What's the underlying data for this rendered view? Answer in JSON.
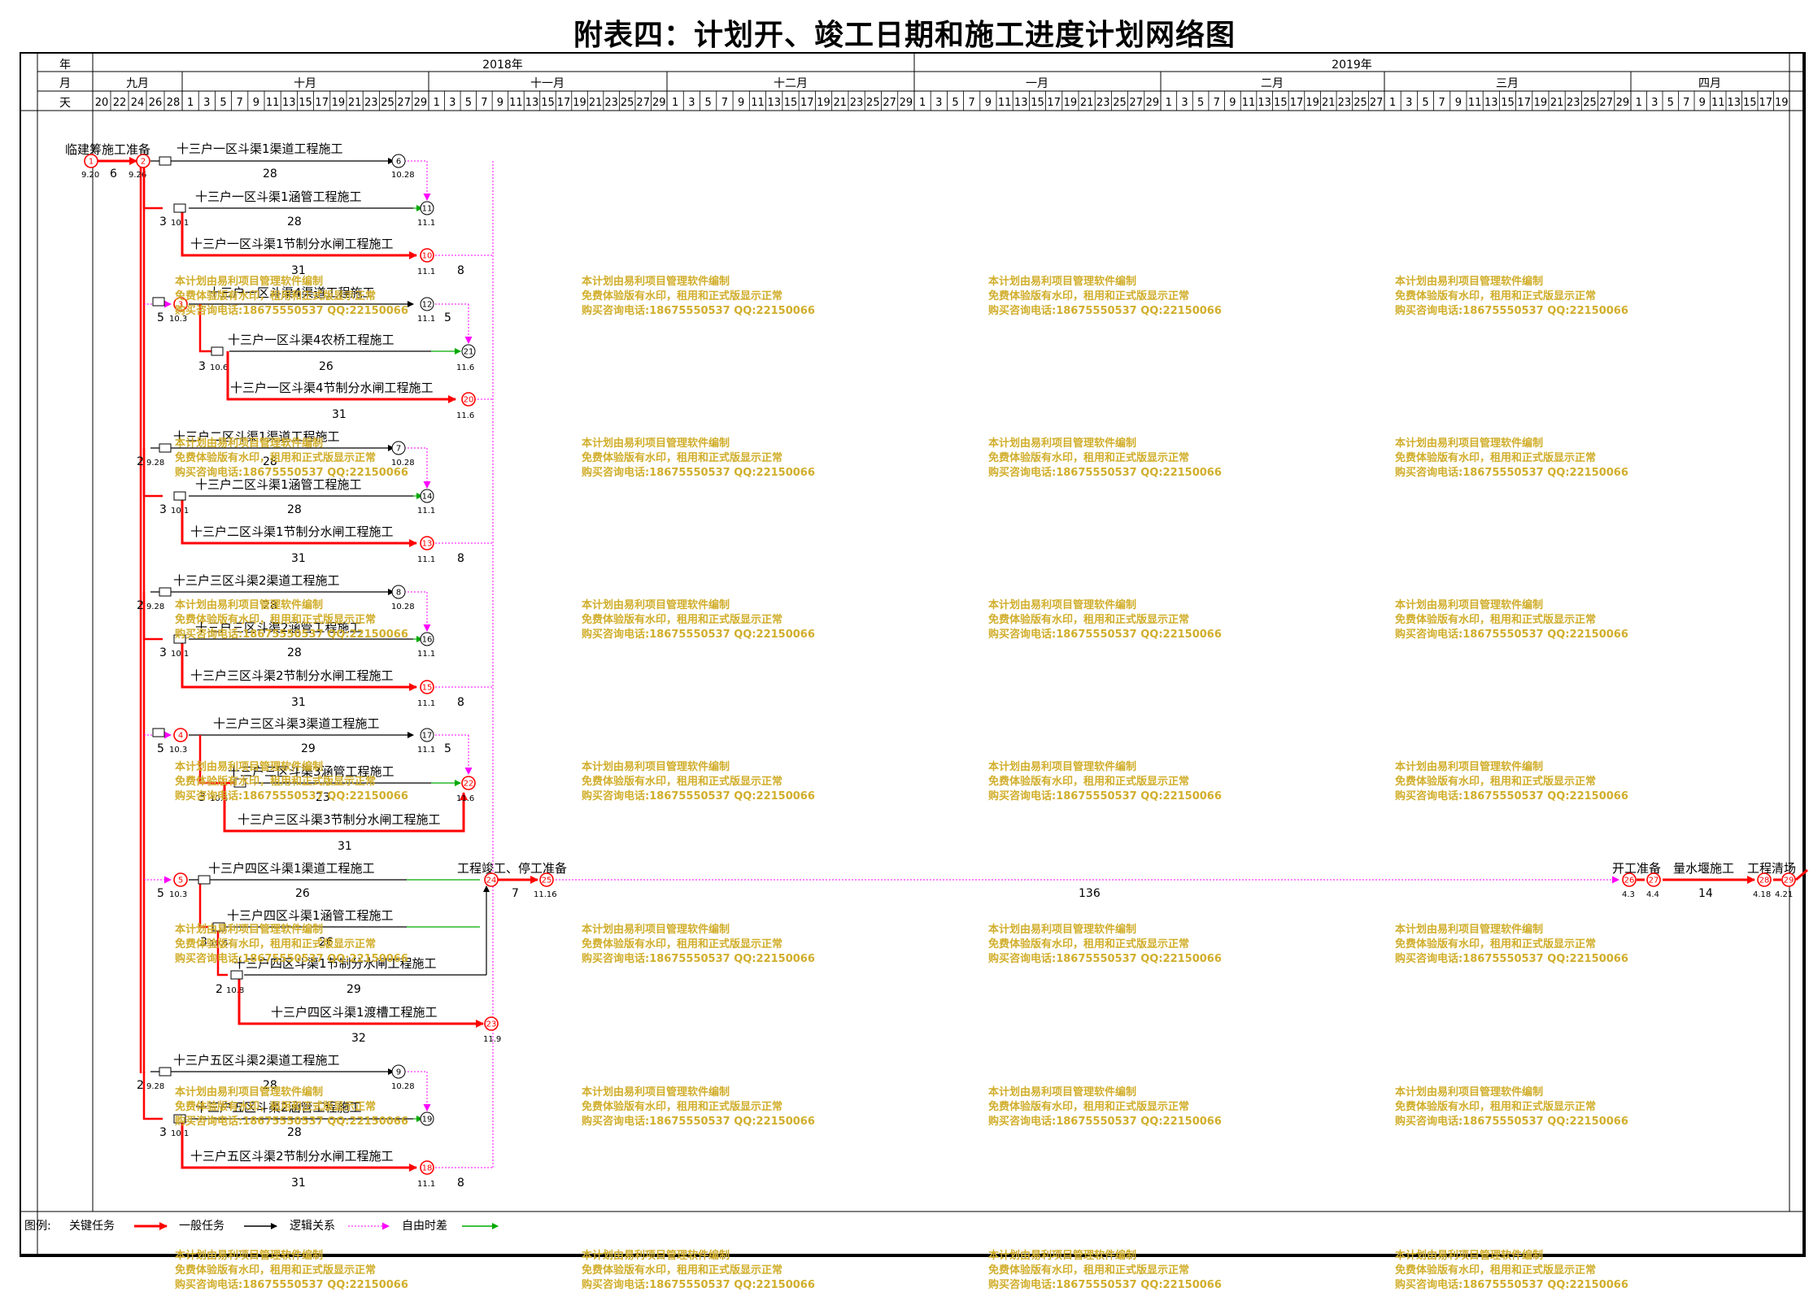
{
  "title": "附表四：计划开、竣工日期和施工进度计划网络图",
  "header": {
    "row_labels": [
      "年",
      "月",
      "天"
    ],
    "years": [
      "2018年",
      "2019年"
    ],
    "months": [
      "九月",
      "十月",
      "十一月",
      "十二月",
      "一月",
      "二月",
      "三月",
      "四月"
    ],
    "sep_days": [
      "20",
      "22",
      "24",
      "26",
      "28"
    ],
    "oct_days": [
      "1",
      "3",
      "5",
      "7",
      "9",
      "11",
      "13",
      "15",
      "17",
      "19",
      "21",
      "23",
      "25",
      "27",
      "29"
    ],
    "nov_days": [
      "1",
      "3",
      "5",
      "7",
      "9",
      "11",
      "13",
      "15",
      "17",
      "19",
      "21",
      "23",
      "25",
      "27",
      "29"
    ],
    "dec_days": [
      "1",
      "3",
      "5",
      "7",
      "9",
      "11",
      "13",
      "15",
      "17",
      "19",
      "21",
      "23",
      "25",
      "27",
      "29"
    ],
    "jan_days": [
      "1",
      "3",
      "5",
      "7",
      "9",
      "11",
      "13",
      "15",
      "17",
      "19",
      "21",
      "23",
      "25",
      "27",
      "29"
    ],
    "feb_days": [
      "1",
      "3",
      "5",
      "7",
      "9",
      "11",
      "13",
      "15",
      "17",
      "19",
      "21",
      "23",
      "25",
      "27"
    ],
    "mar_days": [
      "1",
      "3",
      "5",
      "7",
      "9",
      "11",
      "13",
      "15",
      "17",
      "19",
      "21",
      "23",
      "25",
      "27",
      "29"
    ],
    "apr_days": [
      "1",
      "3",
      "5",
      "7",
      "9",
      "11",
      "13",
      "15",
      "17",
      "19"
    ]
  },
  "tasks": {
    "prep": "临建筹施工准备",
    "r1_canal": "十三户一区斗渠1渠道工程施工",
    "r1_culvert": "十三户一区斗渠1涵管工程施工",
    "r1_sluice": "十三户一区斗渠1节制分水闸工程施工",
    "r1b_canal": "十三户一区斗渠4渠道工程施工",
    "r1b_bridge": "十三户一区斗渠4农桥工程施工",
    "r1b_sluice": "十三户一区斗渠4节制分水闸工程施工",
    "r2_canal": "十三户二区斗渠1渠道工程施工",
    "r2_culvert": "十三户二区斗渠1涵管工程施工",
    "r2_sluice": "十三户二区斗渠1节制分水闸工程施工",
    "r3_canal": "十三户三区斗渠2渠道工程施工",
    "r3_culvert": "十三户三区斗渠2涵管工程施工",
    "r3_sluice": "十三户三区斗渠2节制分水闸工程施工",
    "r3b_canal": "十三户三区斗渠3渠道工程施工",
    "r3b_culvert": "十三户三区斗渠3涵管工程施工",
    "r3b_sluice": "十三户三区斗渠3节制分水闸工程施工",
    "r4_canal": "十三户四区斗渠1渠道工程施工",
    "r4_culvert": "十三户四区斗渠1涵管工程施工",
    "r4_sluice": "十三户四区斗渠1节制分水闸工程施工",
    "r4_flume": "十三户四区斗渠1渡槽工程施工",
    "r5_canal": "十三户五区斗渠2渠道工程施工",
    "r5_culvert": "十三户五区斗渠2涵管工程施工",
    "r5_sluice": "十三户五区斗渠2节制分水闸工程施工",
    "stop": "工程竣工、停工准备",
    "restart": "开工准备",
    "cofferdam": "量水堰施工",
    "cleanup": "工程清场"
  },
  "durations": {
    "prep": "6",
    "r1_canal": "28",
    "r1_culvert": "28",
    "r1_sluice": "31",
    "r1b_bridge": "26",
    "r1b_sluice": "31",
    "r2_canal": "28",
    "r2_culvert": "28",
    "r2_sluice": "31",
    "r3_canal": "28",
    "r3_culvert": "28",
    "r3_sluice": "31",
    "r3b_canal": "29",
    "r3b_culvert": "23",
    "r3b_sluice": "31",
    "r4_canal": "26",
    "r4_culvert": "26",
    "r4_sluice": "29",
    "r4_flume": "32",
    "r5_canal": "28",
    "r5_culvert": "28",
    "r5_sluice": "31",
    "stop": "7",
    "winter": "136",
    "cofferdam": "14",
    "lag3": "3",
    "lag5": "5",
    "lag2": "2",
    "lag8": "8"
  },
  "dates": {
    "d0920": "9.20",
    "d0926": "9.26",
    "d0928": "9.28",
    "d101": "10.1",
    "d103": "10.3",
    "d106": "10.6",
    "d108": "10.8",
    "d1028": "10.28",
    "d111": "11.1",
    "d116": "11.6",
    "d119": "11.9",
    "d1116": "11.16",
    "d43": "4.3",
    "d44": "4.4",
    "d418": "4.18",
    "d421": "4.21"
  },
  "nodes": {
    "n1": "1",
    "n2": "2",
    "n3": "3",
    "n4": "4",
    "n5": "5",
    "n6": "6",
    "n7": "7",
    "n8": "8",
    "n9": "9",
    "n10": "10",
    "n11": "11",
    "n12": "12",
    "n13": "13",
    "n14": "14",
    "n15": "15",
    "n16": "16",
    "n17": "17",
    "n18": "18",
    "n19": "19",
    "n20": "20",
    "n21": "21",
    "n22": "22",
    "n23": "23",
    "n24": "24",
    "n25": "25",
    "n26": "26",
    "n27": "27",
    "n28": "28",
    "n29": "29"
  },
  "watermark": {
    "line1": "本计划由易利项目管理软件编制",
    "line2": "免费体验版有水印，租用和正式版显示正常",
    "line3": "购买咨询电话:18675550537 QQ:22150066"
  },
  "legend": {
    "title": "图例:",
    "critical": "关键任务",
    "general": "一般任务",
    "logic": "逻辑关系",
    "float": "自由时差"
  },
  "colors": {
    "critical": "#ff0000",
    "logic": "#ff00ff",
    "float": "#00aa00",
    "watermark": "#d1ae2c"
  }
}
